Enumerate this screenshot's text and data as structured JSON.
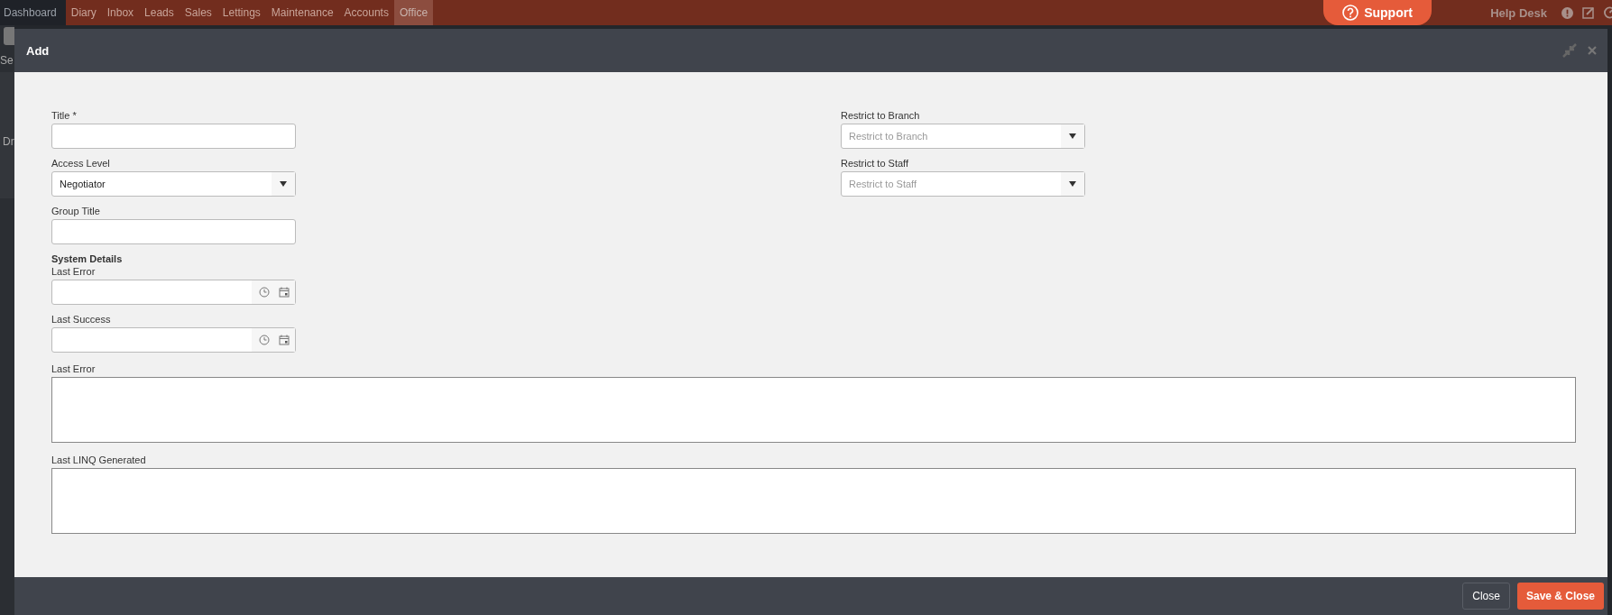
{
  "nav": {
    "home": {
      "label": "Dashboard"
    },
    "tabs": [
      {
        "label": "Diary",
        "selected": false
      },
      {
        "label": "Inbox",
        "selected": false
      },
      {
        "label": "Leads",
        "selected": false
      },
      {
        "label": "Sales",
        "selected": false
      },
      {
        "label": "Lettings",
        "selected": false
      },
      {
        "label": "Maintenance",
        "selected": false
      },
      {
        "label": "Accounts",
        "selected": false
      },
      {
        "label": "Office",
        "selected": true
      }
    ],
    "support": "Support",
    "help_desk": "Help Desk"
  },
  "background": {
    "texts": [
      "Se",
      "Dr"
    ]
  },
  "dialog": {
    "title": "Add",
    "left_fields": [
      {
        "kind": "text",
        "label": "Title *"
      },
      {
        "kind": "select",
        "label": "Access Level",
        "value": "Negotiator"
      },
      {
        "kind": "text",
        "label": "Group Title"
      },
      {
        "kind": "heading",
        "label": "System Details"
      },
      {
        "kind": "datetime",
        "label": "Last Error"
      },
      {
        "kind": "datetime",
        "label": "Last Success"
      }
    ],
    "right_fields": [
      {
        "kind": "select",
        "label": "Restrict to Branch",
        "placeholder": "Restrict to Branch"
      },
      {
        "kind": "select",
        "label": "Restrict to Staff",
        "placeholder": "Restrict to Staff"
      }
    ],
    "wide_fields": [
      {
        "kind": "textarea",
        "label": "Last Error"
      },
      {
        "kind": "textarea",
        "label": "Last LINQ Generated"
      }
    ],
    "buttons": [
      {
        "label": "Close",
        "kind": "secondary"
      },
      {
        "label": "Save & Close",
        "kind": "primary"
      }
    ]
  }
}
